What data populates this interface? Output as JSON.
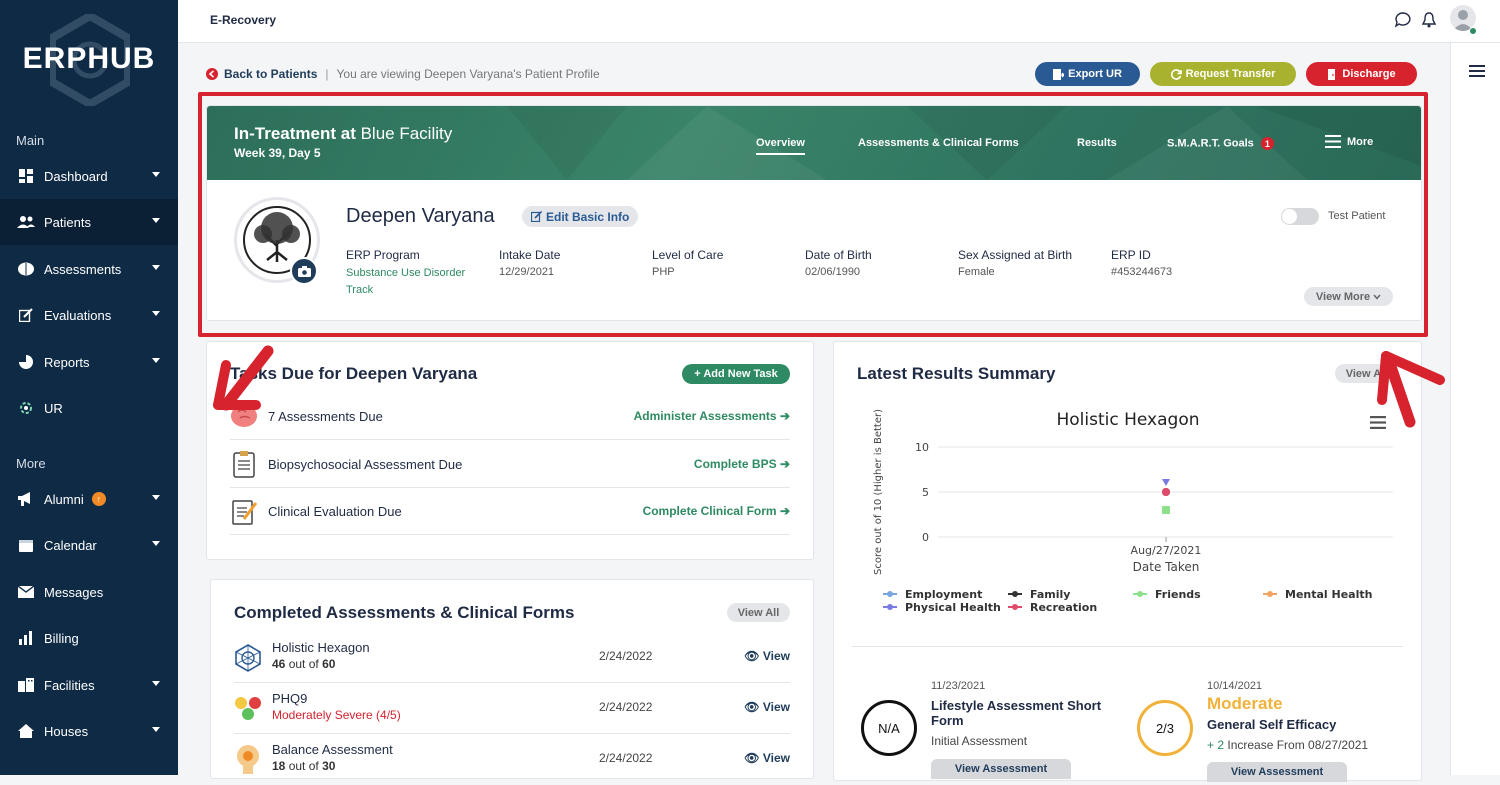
{
  "app": {
    "logo": "ERPHUB",
    "title": "E-Recovery"
  },
  "sidebar": {
    "main_heading": "Main",
    "more_heading": "More",
    "items": [
      {
        "label": "Dashboard",
        "icon": "dashboard-icon"
      },
      {
        "label": "Patients",
        "icon": "patients-icon"
      },
      {
        "label": "Assessments",
        "icon": "brain-icon"
      },
      {
        "label": "Evaluations",
        "icon": "edit-icon"
      },
      {
        "label": "Reports",
        "icon": "pie-chart-icon"
      },
      {
        "label": "UR",
        "icon": "ur-icon"
      },
      {
        "label": "Alumni",
        "icon": "megaphone-icon"
      },
      {
        "label": "Calendar",
        "icon": "calendar-icon"
      },
      {
        "label": "Messages",
        "icon": "envelope-icon"
      },
      {
        "label": "Billing",
        "icon": "bar-chart-icon"
      },
      {
        "label": "Facilities",
        "icon": "building-icon"
      },
      {
        "label": "Houses",
        "icon": "house-icon"
      }
    ]
  },
  "breadcrumb": {
    "back": "Back to Patients",
    "sep": "|",
    "viewing": "You are viewing Deepen Varyana's Patient Profile"
  },
  "actions": {
    "export": "Export UR",
    "transfer": "Request Transfer",
    "discharge": "Discharge"
  },
  "hero": {
    "status": "In-Treatment at",
    "facility": "Blue Facility",
    "week": "Week 39, Day 5",
    "tabs": [
      "Overview",
      "Assessments & Clinical Forms",
      "Results",
      "S.M.A.R.T. Goals",
      "More"
    ],
    "goals_badge": "1"
  },
  "patient": {
    "name": "Deepen Varyana",
    "edit": "Edit Basic Info",
    "test_patient": "Test Patient",
    "fields": [
      {
        "label": "ERP Program",
        "value": "Substance Use Disorder Track"
      },
      {
        "label": "Intake Date",
        "value": "12/29/2021"
      },
      {
        "label": "Level of Care",
        "value": "PHP"
      },
      {
        "label": "Date of Birth",
        "value": "02/06/1990"
      },
      {
        "label": "Sex Assigned at Birth",
        "value": "Female"
      },
      {
        "label": "ERP ID",
        "value": "#453244673"
      }
    ],
    "view_more": "View More"
  },
  "tasks": {
    "title": "Tasks Due for Deepen Varyana",
    "add": "+ Add New Task",
    "rows": [
      {
        "text": "7 Assessments Due",
        "action": "Administer Assessments"
      },
      {
        "text": "Biopsychosocial Assessment Due",
        "action": "Complete BPS"
      },
      {
        "text": "Clinical Evaluation Due",
        "action": "Complete Clinical Form"
      }
    ]
  },
  "completed": {
    "title": "Completed Assessments & Clinical Forms",
    "view_all": "View All",
    "rows": [
      {
        "name": "Holistic Hexagon",
        "score": "46",
        "score_tail": "out of",
        "max": "60",
        "date": "2/24/2022",
        "view": "View"
      },
      {
        "name": "PHQ9",
        "status": "Moderately Severe (4/5)",
        "date": "2/24/2022",
        "view": "View"
      },
      {
        "name": "Balance Assessment",
        "score": "18",
        "score_tail": "out of",
        "max": "30",
        "date": "2/24/2022",
        "view": "View"
      }
    ]
  },
  "results": {
    "title": "Latest Results Summary",
    "view_all": "View All",
    "left": {
      "date": "11/23/2021",
      "name": "Lifestyle Assessment Short Form",
      "sub": "Initial Assessment",
      "score": "N/A",
      "button": "View Assessment"
    },
    "right": {
      "date": "10/14/2021",
      "level": "Moderate",
      "name": "General Self Efficacy",
      "delta": "+ 2",
      "delta_text": "Increase From 08/27/2021",
      "score": "2/3",
      "button": "View Assessment"
    }
  },
  "chart_data": {
    "type": "scatter",
    "title": "Holistic Hexagon",
    "xlabel": "Date Taken",
    "ylabel": "Score out of 10 (Higher is Better)",
    "ylim": [
      0,
      10
    ],
    "yticks": [
      "10",
      "5",
      "0"
    ],
    "x": [
      "Aug/27/2021"
    ],
    "series": [
      {
        "name": "Employment",
        "values": [
          5
        ],
        "color": "#7aa6e0"
      },
      {
        "name": "Family",
        "values": [
          5
        ],
        "color": "#333333"
      },
      {
        "name": "Friends",
        "values": [
          3
        ],
        "color": "#8fe08a"
      },
      {
        "name": "Mental Health",
        "values": [
          5
        ],
        "color": "#f0a460"
      },
      {
        "name": "Physical Health",
        "values": [
          6
        ],
        "color": "#7a7ae0"
      },
      {
        "name": "Recreation",
        "values": [
          5
        ],
        "color": "#e04a6a"
      }
    ],
    "legend": "bottom"
  }
}
